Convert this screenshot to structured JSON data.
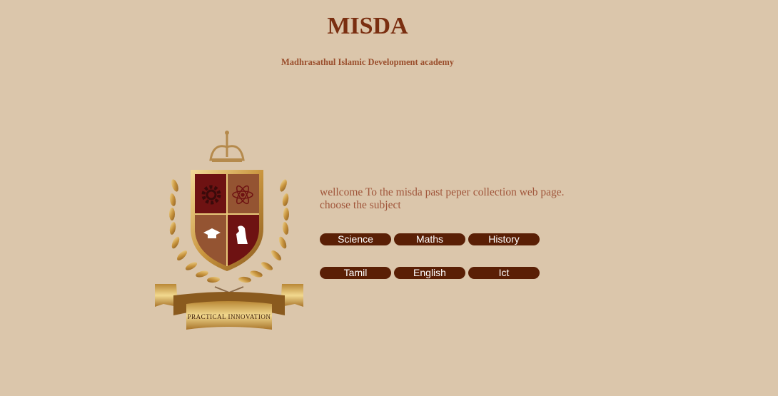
{
  "header": {
    "title": "MISDA",
    "subtitle": "Madhrasathul Islamic Development academy"
  },
  "logo": {
    "motto": "Practical Innovation",
    "icons": [
      "crown-icon",
      "gear-icon",
      "atom-icon",
      "graduation-cap-icon",
      "chess-knight-icon",
      "laurel-icon"
    ]
  },
  "main": {
    "welcome_line1": "wellcome To the misda past peper collection web page.",
    "welcome_line2": "choose the subject",
    "subjects_row1": [
      "Science",
      "Maths",
      "History"
    ],
    "subjects_row2": [
      "Tamil",
      "English",
      "Ict"
    ]
  },
  "colors": {
    "background": "#dbc6ab",
    "title": "#7a2e10",
    "button": "#5a1f05",
    "gold": "#c9a04a",
    "shield_red": "#6e1212"
  }
}
